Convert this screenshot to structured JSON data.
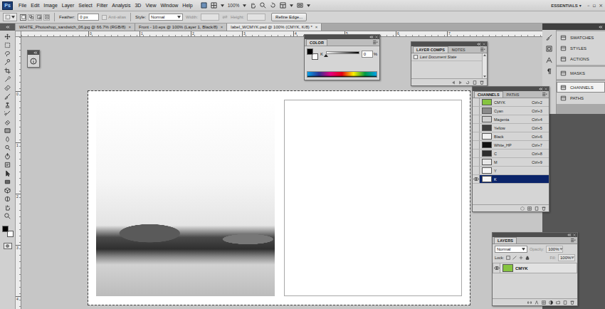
{
  "app": {
    "logo": "Ps"
  },
  "menu": [
    "File",
    "Edit",
    "Image",
    "Layer",
    "Select",
    "Filter",
    "Analysis",
    "3D",
    "View",
    "Window",
    "Help"
  ],
  "menubar_zoom": "100%",
  "workspace_switcher": {
    "label": "ESSENTIALS",
    "arrow": "▾"
  },
  "window_controls": [
    "–",
    "▫",
    "×"
  ],
  "options_bar": {
    "feather_label": "Feather:",
    "feather_value": "0 px",
    "anti_alias": {
      "label": "Anti-alias",
      "checked": false,
      "disabled": true
    },
    "style_label": "Style:",
    "style_value": "Normal",
    "width_label": "Width:",
    "height_label": "Height:",
    "size_disabled": true,
    "refine_edge": "Refine Edge..."
  },
  "document_tabs": [
    {
      "label": "WHITE_Photoshop_sandwich_06.jpg @ 66.7% (RGB/8)",
      "selected": false
    },
    {
      "label": "Front - 10.eps @ 100% (Layer 1, Black/8)",
      "selected": false
    },
    {
      "label": "label_WCMYK.psd @ 100% (CMYK, K/8) *",
      "selected": true
    }
  ],
  "tab_close": "×",
  "rulers": {
    "top": [
      "0",
      "1",
      "2",
      "3",
      "4",
      "5",
      "6",
      "7"
    ],
    "left": [
      "0",
      "1",
      "2",
      "3",
      "4"
    ]
  },
  "color_panel": {
    "title": "COLOR",
    "slider": {
      "label": "K",
      "level": 0,
      "value": "0",
      "unit": "%"
    }
  },
  "layer_comps_panel": {
    "tabs": [
      {
        "label": "LAYER COMPS",
        "selected": true
      },
      {
        "label": "NOTES",
        "selected": false
      }
    ],
    "items": [
      {
        "label": "Last Document State",
        "selected": false
      }
    ]
  },
  "channels_panel": {
    "tabs": [
      {
        "label": "CHANNELS",
        "selected": true
      },
      {
        "label": "PATHS",
        "selected": false
      }
    ],
    "channels": [
      {
        "name": "CMYK",
        "shortcut": "Ctrl+2",
        "visible": false,
        "selected": false,
        "color": "#86c440"
      },
      {
        "name": "Cyan",
        "shortcut": "Ctrl+3",
        "visible": false,
        "selected": false,
        "color": "#8a8a8a"
      },
      {
        "name": "Magenta",
        "shortcut": "Ctrl+4",
        "visible": false,
        "selected": false,
        "color": "#cfcfcf"
      },
      {
        "name": "Yellow",
        "shortcut": "Ctrl+5",
        "visible": false,
        "selected": false,
        "color": "#3e3e3e"
      },
      {
        "name": "Black",
        "shortcut": "Ctrl+6",
        "visible": false,
        "selected": false,
        "color": "#f2f2f2"
      },
      {
        "name": "White_HP",
        "shortcut": "Ctrl+7",
        "visible": false,
        "selected": false,
        "color": "#111111"
      },
      {
        "name": "C",
        "shortcut": "Ctrl+8",
        "visible": false,
        "selected": false,
        "color": "#2e2e2e"
      },
      {
        "name": "M",
        "shortcut": "Ctrl+9",
        "visible": false,
        "selected": false,
        "color": "#e6e6e6"
      },
      {
        "name": "Y",
        "shortcut": "",
        "visible": false,
        "selected": false,
        "color": "#f6f6f6"
      },
      {
        "name": "K",
        "shortcut": "",
        "visible": true,
        "selected": true,
        "color": "#f6f6f6"
      }
    ]
  },
  "layers_panel": {
    "title": "LAYERS",
    "blend_mode": "Normal",
    "opacity_label": "Opacity:",
    "opacity": "100%",
    "lock_label": "Lock:",
    "fill_label": "Fill:",
    "fill": "100%",
    "layers": [
      {
        "name": "CMYK",
        "visible": true,
        "selected": false,
        "color": "#86c440"
      }
    ]
  },
  "dock": {
    "groups": [
      [
        {
          "label": "SWATCHES",
          "selected": false
        },
        {
          "label": "STYLES",
          "selected": false
        },
        {
          "label": "ACTIONS",
          "selected": false
        }
      ],
      [
        {
          "label": "MASKS",
          "selected": false
        }
      ],
      [
        {
          "label": "CHANNELS",
          "selected": true
        },
        {
          "label": "PATHS",
          "selected": false
        }
      ]
    ]
  }
}
